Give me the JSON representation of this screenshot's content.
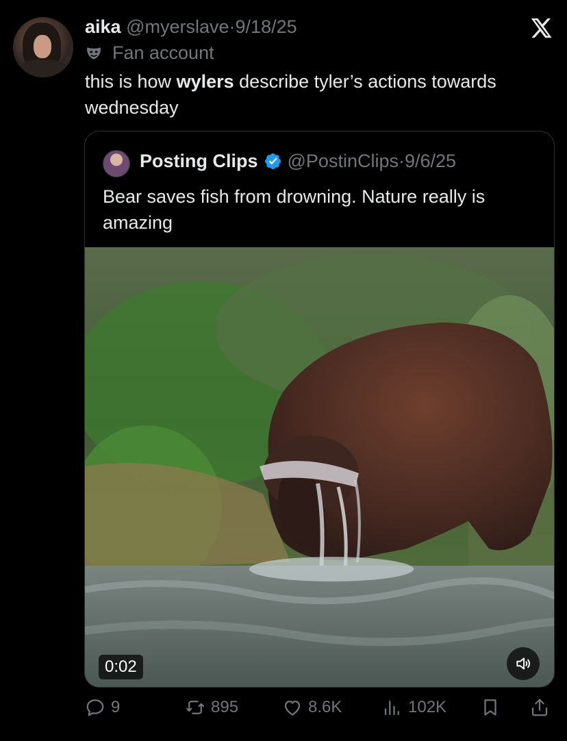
{
  "post": {
    "name": "aika",
    "handle": "@myerslave",
    "separator": "·",
    "date": "9/18/25",
    "label": "Fan account",
    "text_before": "this is how ",
    "text_bold": "wylers",
    "text_after": " describe tyler’s actions towards wednesday"
  },
  "quoted": {
    "name": "Posting Clips",
    "handle": "@PostinClips",
    "separator": "·",
    "date": "9/6/25",
    "text": "Bear saves fish from drowning. Nature really is amazing",
    "video_time": "0:02"
  },
  "actions": {
    "replies": "9",
    "reposts": "895",
    "likes": "8.6K",
    "views": "102K"
  },
  "colors": {
    "background": "#000000",
    "primary_text": "#e7e9ea",
    "secondary_text": "#71767b",
    "verified": "#1d9bf0",
    "border": "#2f3336"
  },
  "icons": [
    "x-logo-icon",
    "mask-icon",
    "verified-badge-icon",
    "volume-icon",
    "reply-icon",
    "repost-icon",
    "like-icon",
    "views-icon",
    "bookmark-icon",
    "share-icon"
  ]
}
